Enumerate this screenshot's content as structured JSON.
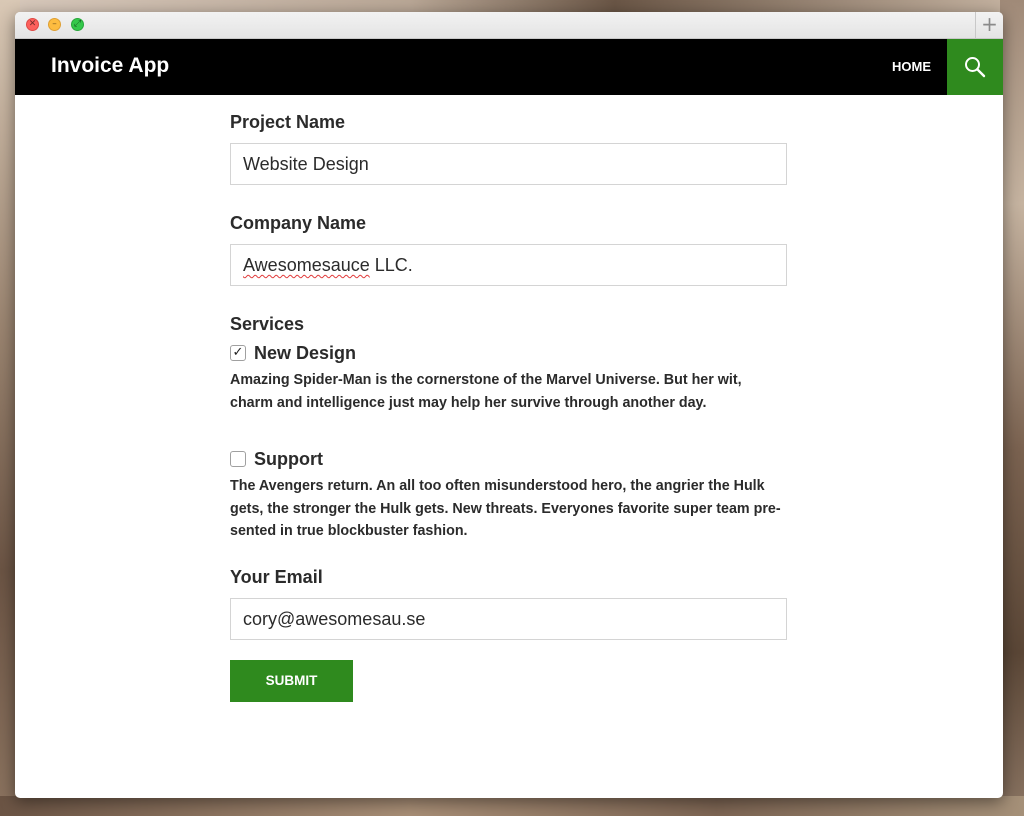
{
  "window": {
    "new_tab_glyph": "+",
    "traffic_lights": {
      "close_glyph": "✕",
      "minimize_glyph": "–",
      "zoom_glyph": "⤢"
    }
  },
  "navbar": {
    "brand": "Invoice App",
    "home_link": "HOME",
    "search_icon": "search-icon",
    "search_bg_color": "#2f8a1e"
  },
  "form": {
    "project_name": {
      "label": "Project Name",
      "value": "Website Design"
    },
    "company_name": {
      "label": "Company Name",
      "value_misspelled": "Awesomesauce",
      "value_rest": " LLC."
    },
    "services": {
      "label": "Services",
      "items": [
        {
          "title": "New Design",
          "checked": true,
          "check_glyph": "✓",
          "description": "Amazing Spider-Man is the cornerstone of the Marvel Universe. But her wit, charm and intelligence just may help her survive through another day."
        },
        {
          "title": "Support",
          "checked": false,
          "check_glyph": "",
          "description": "The Avengers return. An all too often misunderstood hero, the angrier the Hulk gets, the stronger the Hulk gets. New threats. Everyones favorite super team pre-sented in true blockbuster fashion."
        }
      ]
    },
    "email": {
      "label": "Your Email",
      "value": "cory@awesomesau.se"
    },
    "submit_label": "SUBMIT",
    "accent_color": "#2f8a1e"
  }
}
